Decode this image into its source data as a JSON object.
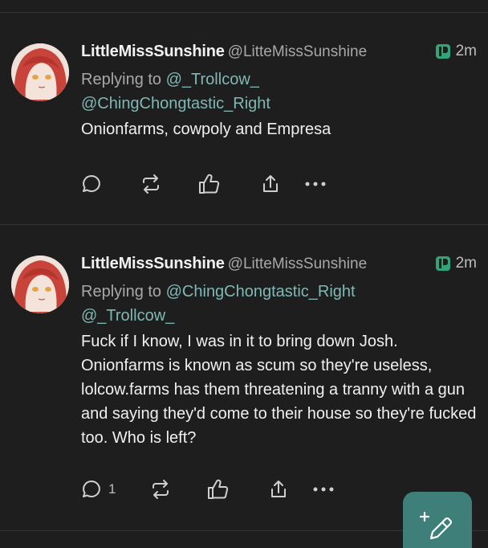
{
  "posts": [
    {
      "display_name": "LittleMissSunshine",
      "handle": "@LitteMissSunshine",
      "time": "2m",
      "replying_prefix": "Replying to ",
      "mention_1": "@_Trollcow_",
      "mention_2": "@ChingChongtastic_Right",
      "body": "Onionfarms, cowpoly and Empresa",
      "reply_count": ""
    },
    {
      "display_name": "LittleMissSunshine",
      "handle": "@LitteMissSunshine",
      "time": "2m",
      "replying_prefix": "Replying to ",
      "mention_1": "@ChingChongtastic_Right",
      "mention_2": "@_Trollcow_",
      "body": "Fuck if I know, I was in it to bring down Josh. Onionfarms is known as scum so they're useless, lolcow.farms has them threatening a tranny with a gun and saying they'd come to their house so they're fucked too. Who is left?",
      "reply_count": "1"
    }
  ],
  "colors": {
    "background": "#1e1e1e",
    "mention": "#7fb8b4",
    "fab": "#3f7f7a",
    "platform_badge": "#35a37a"
  },
  "icons": {
    "reply": "speech-bubble-icon",
    "boost": "repost-arrows-icon",
    "like": "thumbs-up-icon",
    "share": "share-icon",
    "more": "ellipsis-icon",
    "compose": "pencil-plus-icon",
    "platform": "pleroma-badge-icon"
  }
}
